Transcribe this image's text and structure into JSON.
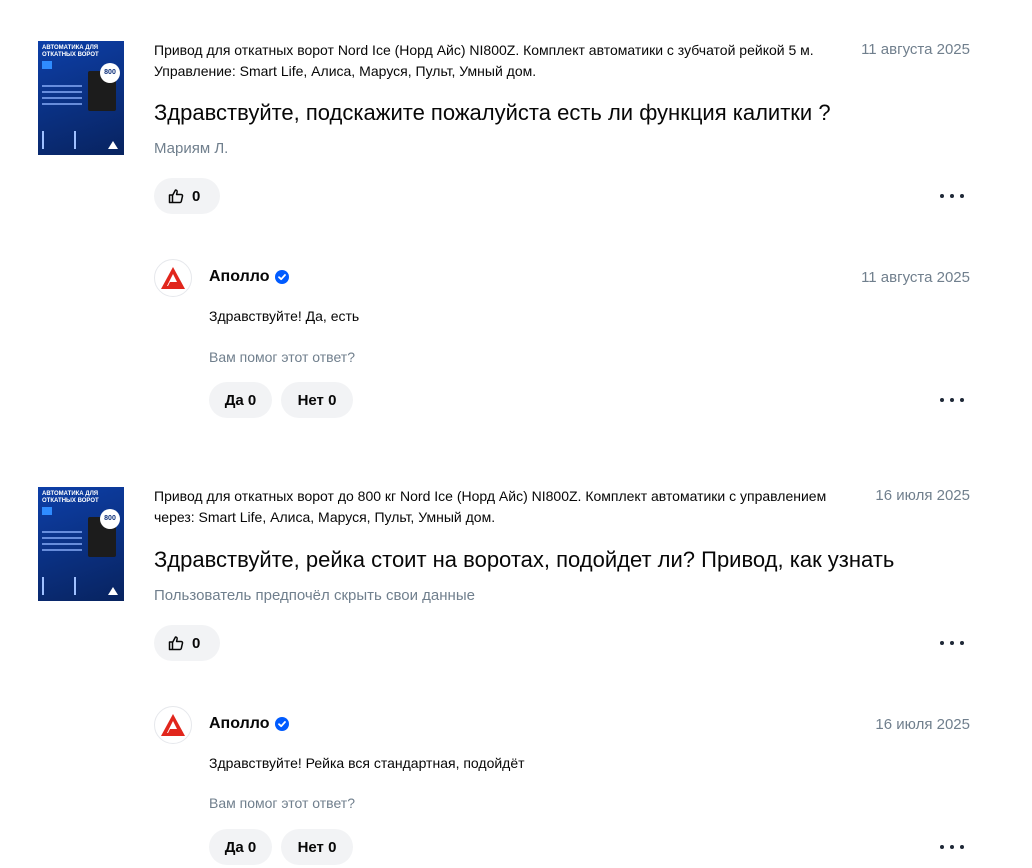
{
  "questions": [
    {
      "thumb": {
        "title": "АВТОМАТИКА ДЛЯ ОТКАТНЫХ ВОРОТ",
        "badge": "800"
      },
      "product": "Привод для откатных ворот Nord Ice (Норд Айс) NI800Z. Комплект автоматики с зубчатой рейкой 5 м. Управление: Smart Life, Алиса, Маруся, Пульт, Умный дом.",
      "date": "11 августа 2025",
      "text": "Здравствуйте, подскажите пожалуйста есть ли функция калитки ?",
      "author": "Мариям Л.",
      "likes": "0",
      "answer": {
        "brand": "Аполло",
        "date": "11 августа 2025",
        "text": "Здравствуйте! Да, есть",
        "helpful_prompt": "Вам помог этот ответ?",
        "yes": "Да 0",
        "no": "Нет 0"
      }
    },
    {
      "thumb": {
        "title": "АВТОМАТИКА ДЛЯ ОТКАТНЫХ ВОРОТ",
        "badge": "800"
      },
      "product": "Привод для откатных ворот до 800 кг Nord Ice (Норд Айс) NI800Z. Комплект автоматики с управлением через: Smart Life, Алиса, Маруся, Пульт, Умный дом.",
      "date": "16 июля 2025",
      "text": "Здравствуйте, рейка стоит на воротах, подойдет ли? Привод, как узнать",
      "author": "Пользователь предпочёл скрыть свои данные",
      "likes": "0",
      "answer": {
        "brand": "Аполло",
        "date": "16 июля 2025",
        "text": "Здравствуйте! Рейка вся стандартная, подойдёт",
        "helpful_prompt": "Вам помог этот ответ?",
        "yes": "Да 0",
        "no": "Нет 0"
      }
    }
  ],
  "icons": {
    "like": "thumbs-up-icon",
    "more": "more-dots-icon",
    "verified": "verified-check-icon",
    "brand_logo": "apollo-logo-icon"
  },
  "colors": {
    "muted": "#707f8d",
    "chip": "#f2f3f5",
    "verified": "#005bff",
    "brand_red": "#e1261c"
  }
}
